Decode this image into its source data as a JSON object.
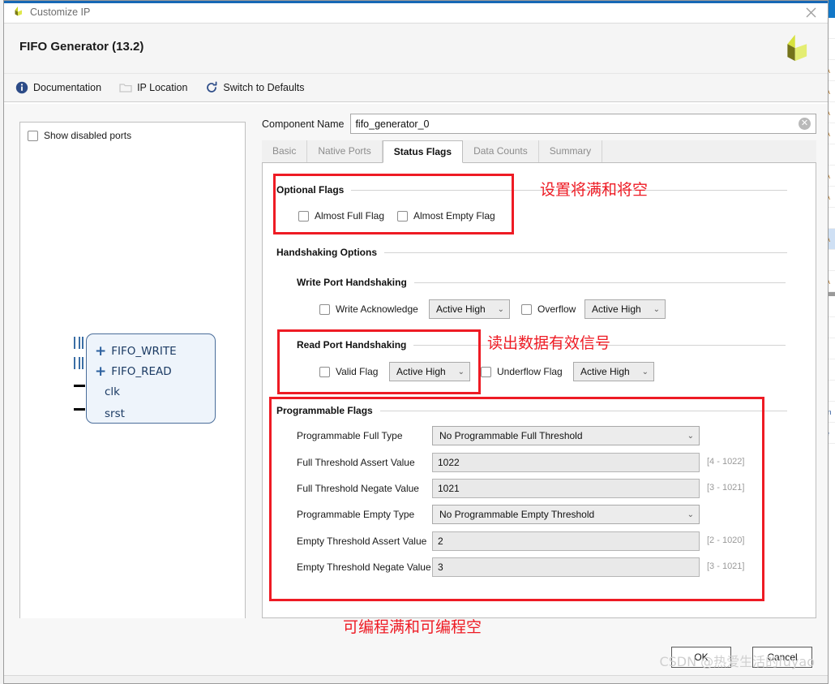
{
  "window": {
    "title": "Customize IP",
    "close_icon": "close-icon",
    "app_icon": "xilinx-logo-icon"
  },
  "header": {
    "page_title": "FIFO Generator (13.2)",
    "brand_logo": "xilinx-logo"
  },
  "toolbar": {
    "items": [
      {
        "label": "Documentation",
        "icon": "info-icon"
      },
      {
        "label": "IP Location",
        "icon": "folder-icon"
      },
      {
        "label": "Switch to Defaults",
        "icon": "refresh-icon"
      }
    ]
  },
  "ports_panel": {
    "show_disabled_ports": {
      "label": "Show disabled ports",
      "checked": false
    },
    "block": {
      "ports": [
        {
          "name": "FIFO_WRITE",
          "kind": "bus",
          "expandable": true
        },
        {
          "name": "FIFO_READ",
          "kind": "bus",
          "expandable": true
        },
        {
          "name": "clk",
          "kind": "wire",
          "expandable": false
        },
        {
          "name": "srst",
          "kind": "wire",
          "expandable": false
        }
      ]
    }
  },
  "component": {
    "label": "Component Name",
    "value": "fifo_generator_0",
    "placeholder": "",
    "clear_icon": "clear-icon"
  },
  "tabs": [
    {
      "label": "Basic",
      "active": false
    },
    {
      "label": "Native Ports",
      "active": false
    },
    {
      "label": "Status Flags",
      "active": true
    },
    {
      "label": "Data Counts",
      "active": false
    },
    {
      "label": "Summary",
      "active": false
    }
  ],
  "status_flags": {
    "optional_flags": {
      "heading": "Optional Flags",
      "checkboxes": [
        {
          "label": "Almost Full Flag",
          "checked": false
        },
        {
          "label": "Almost Empty Flag",
          "checked": false
        }
      ]
    },
    "handshaking": {
      "heading": "Handshaking Options",
      "write_port": {
        "heading": "Write Port Handshaking",
        "rows": [
          {
            "checkbox_label": "Write Acknowledge",
            "checked": false,
            "select_value": "Active High"
          },
          {
            "checkbox_label": "Overflow",
            "checked": false,
            "select_value": "Active High"
          }
        ]
      },
      "read_port": {
        "heading": "Read Port Handshaking",
        "rows": [
          {
            "checkbox_label": "Valid Flag",
            "checked": false,
            "select_value": "Active High"
          },
          {
            "checkbox_label": "Underflow Flag",
            "checked": false,
            "select_value": "Active High"
          }
        ]
      }
    },
    "programmable_flags": {
      "heading": "Programmable Flags",
      "rows": [
        {
          "label": "Programmable Full Type",
          "type": "select",
          "value": "No Programmable Full Threshold",
          "range": ""
        },
        {
          "label": "Full Threshold Assert Value",
          "type": "text",
          "value": "1022",
          "range": "[4 - 1022]"
        },
        {
          "label": "Full Threshold Negate Value",
          "type": "text",
          "value": "1021",
          "range": "[3 - 1021]"
        },
        {
          "label": "Programmable Empty Type",
          "type": "select",
          "value": "No Programmable Empty Threshold",
          "range": ""
        },
        {
          "label": "Empty Threshold Assert Value",
          "type": "text",
          "value": "2",
          "range": "[2 - 1020]"
        },
        {
          "label": "Empty Threshold Negate Value",
          "type": "text",
          "value": "3",
          "range": "[3 - 1021]"
        }
      ]
    }
  },
  "annotations": {
    "color": "#ee1b24",
    "notes": [
      {
        "text": "设置将满和将空"
      },
      {
        "text": "读出数据有效信号"
      },
      {
        "text": "可编程满和可编程空"
      }
    ]
  },
  "footer": {
    "ok_label": "OK",
    "cancel_label": "Cancel",
    "watermark": "CSDN @热爱生活的fuyao"
  }
}
